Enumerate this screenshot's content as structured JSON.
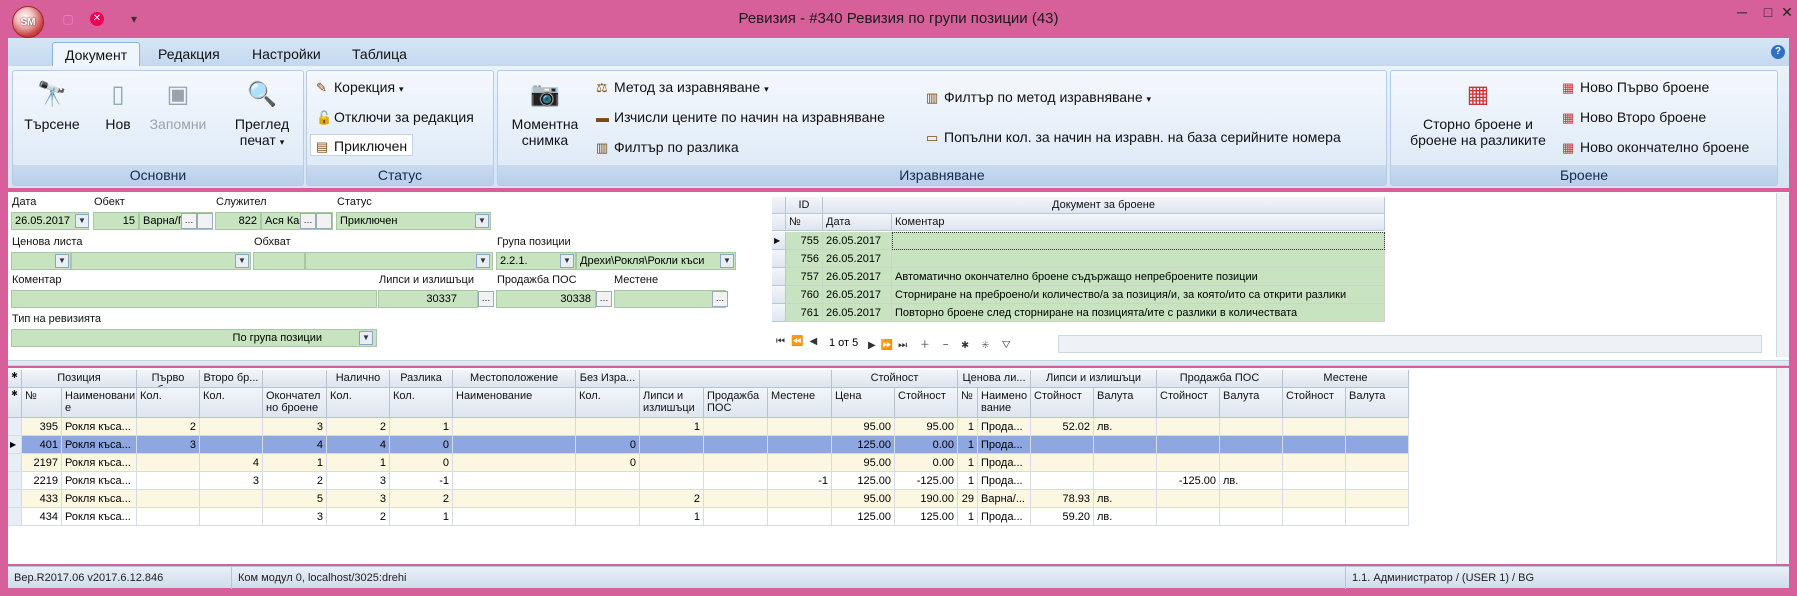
{
  "window": {
    "title": "Ревизия - #340 Ревизия по групи позиции (43)",
    "orb_label": "SM"
  },
  "qat": {
    "save_icon": "save-icon",
    "close_icon": "close-icon",
    "customize_icon": "dropdown-icon"
  },
  "ribbon": {
    "tabs": [
      "Документ",
      "Редакция",
      "Настройки",
      "Таблица"
    ],
    "groups": {
      "basic": {
        "label": "Основни",
        "search": "Търсене",
        "new": "Нов",
        "save": "Запомни",
        "preview_l1": "Преглед",
        "preview_l2": "печат"
      },
      "status": {
        "label": "Статус",
        "correction": "Корекция",
        "unlock": "Отключи за редакция",
        "closed": "Приключен"
      },
      "equalize": {
        "label": "Изравняване",
        "snap_l1": "Моментна",
        "snap_l2": "снимка",
        "method": "Метод за изравняване",
        "clear_prices": "Изчисли цените по начин на изравняване",
        "filter_diff": "Филтър по разлика",
        "filter_method": "Филтър по метод изравняване",
        "fill_qty": "Попълни кол. за начин на изравн. на база серийните номера"
      },
      "counting": {
        "label": "Броене",
        "storno_l1": "Сторно броене и",
        "storno_l2": "броене на разликите",
        "new_first": "Ново Първо броене",
        "new_second": "Ново Второ броене",
        "new_final": "Ново окончателно броене"
      }
    }
  },
  "form": {
    "date_label": "Дата",
    "date": "26.05.2017",
    "object_label": "Обект",
    "object_id": "15",
    "object_name": "Варна/Г",
    "employee_label": "Служител",
    "employee_id": "822",
    "employee_name": "Ася Каб",
    "status_label": "Статус",
    "status": "Приключен",
    "pricelist_label": "Ценова листа",
    "scope_label": "Обхват",
    "group_label": "Група позиции",
    "group_code": "2.2.1.",
    "group_name": "Дрехи\\Рокля\\Рокли къси",
    "comment_label": "Коментар",
    "shortages_label": "Липси и излишъци",
    "shortages": "30337",
    "pos_label": "Продажба ПОС",
    "pos": "30338",
    "move_label": "Местене",
    "type_label": "Тип на ревизията",
    "type": "По група позиции"
  },
  "doc_grid": {
    "col_id": "ID",
    "group_header": "Документ за броене",
    "col_no": "№",
    "col_date": "Дата",
    "col_comment": "Коментар",
    "rows": [
      {
        "id": "755",
        "date": "26.05.2017",
        "comment": ""
      },
      {
        "id": "756",
        "date": "26.05.2017",
        "comment": ""
      },
      {
        "id": "757",
        "date": "26.05.2017",
        "comment": "Автоматично окончателно броене съдържащо непреброените позиции"
      },
      {
        "id": "760",
        "date": "26.05.2017",
        "comment": "Сторниране на преброено/и количество/а за позиция/и, за която/ито са открити разлики"
      },
      {
        "id": "761",
        "date": "26.05.2017",
        "comment": "Повторно броене след сторниране на позицията/ите с разлики в количествата"
      }
    ],
    "nav_text": "1 от 5"
  },
  "main_grid": {
    "bands": [
      "Позиция",
      "Първо бр...",
      "Второ бр...",
      "",
      "Налично",
      "Разлика",
      "Местоположение",
      "Без Изра...",
      "",
      "Стойност",
      "Ценова ли...",
      "Липси и излишъци",
      "Продажба ПОС",
      "Местене"
    ],
    "cols": [
      "№",
      "Наименовани е",
      "Кол.",
      "Кол.",
      "Окончател но броене",
      "Кол.",
      "Кол.",
      "Наименование",
      "Кол.",
      "Липси и излишъци",
      "Продажба ПОС",
      "Местене",
      "Цена",
      "Стойност",
      "№",
      "Наимено вание",
      "Стойност",
      "Валута",
      "Стойност",
      "Валута",
      "Стойност",
      "Валута"
    ],
    "rows": [
      [
        "395",
        "Рокля къса...",
        "2",
        "",
        "3",
        "2",
        "1",
        "",
        "",
        "1",
        "",
        "",
        "95.00",
        "95.00",
        "1",
        "Прода...",
        "52.02",
        "лв.",
        "",
        "",
        "",
        ""
      ],
      [
        "401",
        "Рокля къса...",
        "3",
        "",
        "4",
        "4",
        "0",
        "",
        "0",
        "",
        "",
        "",
        "125.00",
        "0.00",
        "1",
        "Прода...",
        "",
        "",
        "",
        "",
        "",
        ""
      ],
      [
        "2197",
        "Рокля къса...",
        "",
        "4",
        "1",
        "1",
        "0",
        "",
        "0",
        "",
        "",
        "",
        "95.00",
        "0.00",
        "1",
        "Прода...",
        "",
        "",
        "",
        "",
        "",
        ""
      ],
      [
        "2219",
        "Рокля къса...",
        "",
        "3",
        "2",
        "3",
        "-1",
        "",
        "",
        "",
        "",
        "-1",
        "125.00",
        "-125.00",
        "1",
        "Прода...",
        "",
        "",
        "-125.00",
        "лв.",
        "",
        ""
      ],
      [
        "433",
        "Рокля къса...",
        "",
        "",
        "5",
        "3",
        "2",
        "",
        "",
        "2",
        "",
        "",
        "95.00",
        "190.00",
        "29",
        "Варна/...",
        "78.93",
        "лв.",
        "",
        "",
        "",
        ""
      ],
      [
        "434",
        "Рокля къса...",
        "",
        "",
        "3",
        "2",
        "1",
        "",
        "",
        "1",
        "",
        "",
        "125.00",
        "125.00",
        "1",
        "Прода...",
        "59.20",
        "лв.",
        "",
        "",
        "",
        ""
      ]
    ]
  },
  "status": {
    "version": "Вер.R2017.06 v2017.6.12.846",
    "com": "Ком модул 0, localhost/3025:drehi",
    "user": "1.1. Администратор /  (USER 1) / BG"
  }
}
